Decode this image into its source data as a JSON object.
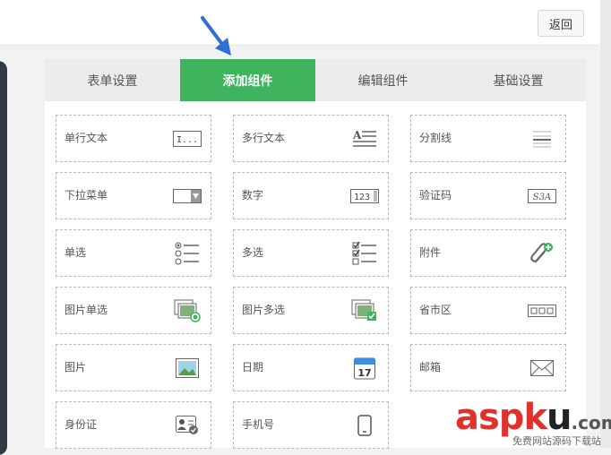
{
  "toolbar": {
    "back_label": "返回"
  },
  "tabs": [
    {
      "label": "表单设置",
      "active": false
    },
    {
      "label": "添加组件",
      "active": true
    },
    {
      "label": "编辑组件",
      "active": false
    },
    {
      "label": "基础设置",
      "active": false
    }
  ],
  "fields": [
    {
      "label": "单行文本",
      "icon": "single-line-text-icon"
    },
    {
      "label": "多行文本",
      "icon": "multi-line-text-icon"
    },
    {
      "label": "分割线",
      "icon": "divider-icon"
    },
    {
      "label": "下拉菜单",
      "icon": "dropdown-icon"
    },
    {
      "label": "数字",
      "icon": "number-icon"
    },
    {
      "label": "验证码",
      "icon": "captcha-icon"
    },
    {
      "label": "单选",
      "icon": "radio-icon"
    },
    {
      "label": "多选",
      "icon": "checkbox-icon"
    },
    {
      "label": "附件",
      "icon": "attachment-icon"
    },
    {
      "label": "图片单选",
      "icon": "image-radio-icon"
    },
    {
      "label": "图片多选",
      "icon": "image-checkbox-icon"
    },
    {
      "label": "省市区",
      "icon": "region-icon"
    },
    {
      "label": "图片",
      "icon": "image-icon"
    },
    {
      "label": "日期",
      "icon": "calendar-icon"
    },
    {
      "label": "邮箱",
      "icon": "mail-icon"
    },
    {
      "label": "身份证",
      "icon": "id-card-icon"
    },
    {
      "label": "手机号",
      "icon": "mobile-icon"
    }
  ],
  "icon_text": {
    "single_line": "I...",
    "number": "123",
    "captcha": "S3A",
    "calendar": "17"
  },
  "watermark": {
    "brand_a": "asp",
    "brand_k": "k",
    "brand_u": "u",
    "brand_dot": ".com",
    "tagline": "免费网站源码下载站"
  },
  "colors": {
    "accent": "#3fb35e",
    "arrow": "#2f6fd6",
    "watermark": "#e0312c"
  }
}
